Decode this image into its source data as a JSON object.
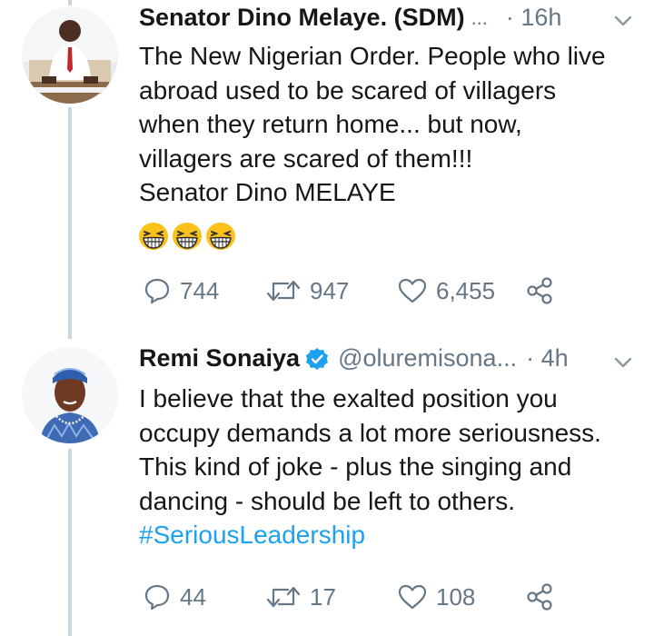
{
  "colors": {
    "text": "#14171a",
    "muted": "#657786",
    "link": "#1da1f2",
    "verified": "#1da1f2",
    "thread_line": "#ccd6dd"
  },
  "tweets": [
    {
      "author_name": "Senator Dino Melaye. (SDM)",
      "name_truncation": "...",
      "time": "· 16h",
      "lines": [
        "The New Nigerian Order. People who live",
        "abroad used to be scared of villagers",
        "when they return home... but now,",
        "villagers are scared of them!!!",
        "Senator Dino MELAYE"
      ],
      "emoji": "grinning-squinting-face x3",
      "stats": {
        "replies": "744",
        "retweets": "947",
        "likes": "6,455"
      }
    },
    {
      "author_name": "Remi Sonaiya",
      "verified": true,
      "handle": "@oluremisona...",
      "time": "· 4h",
      "lines": [
        "I believe that the exalted position you",
        "occupy demands a lot more seriousness.",
        "This kind of joke - plus the singing and",
        "dancing - should be left to others."
      ],
      "hashtag": "#SeriousLeadership",
      "stats": {
        "replies": "44",
        "retweets": "17",
        "likes": "108"
      }
    }
  ],
  "icons": [
    "reply-icon",
    "retweet-icon",
    "like-icon",
    "share-icon",
    "chevron-down-icon",
    "verified-badge-icon"
  ]
}
